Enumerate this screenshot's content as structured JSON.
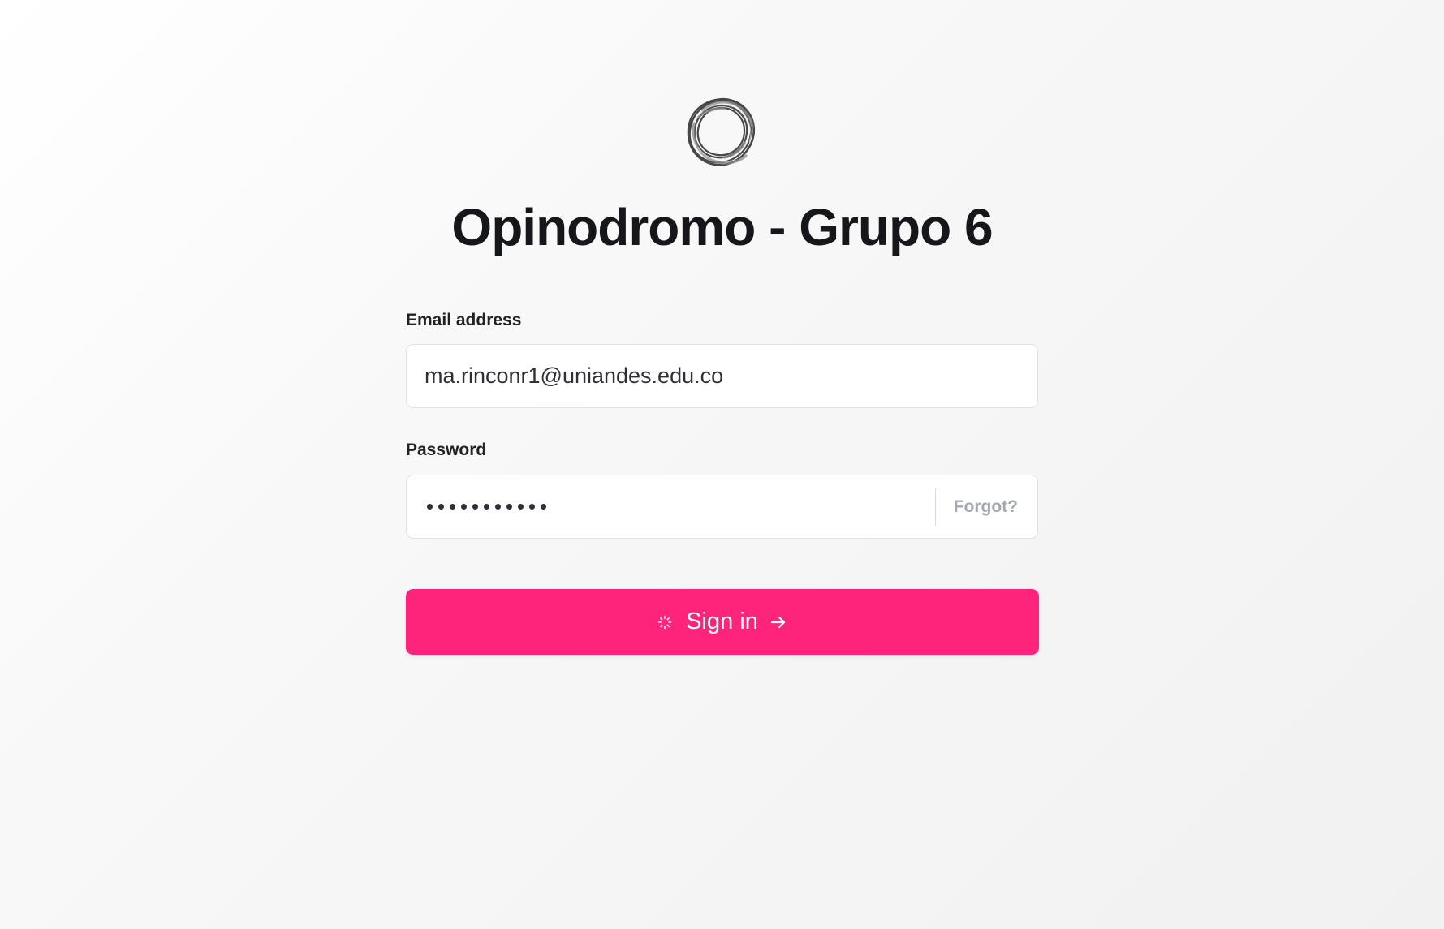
{
  "app": {
    "title": "Opinodromo - Grupo 6"
  },
  "logo": {
    "icon": "ring-logo-icon",
    "description": "Circular line-art logo"
  },
  "form": {
    "email_label": "Email address",
    "email_value": "ma.rinconr1@uniandes.edu.co",
    "password_label": "Password",
    "password_value": "•••••••••••",
    "forgot_label": "Forgot?",
    "submit_label": "Sign in"
  },
  "theme": {
    "accent": "#ff247b",
    "input_border": "#dfe3e8",
    "muted_text": "#a3a9b3",
    "title_text": "#16171b"
  }
}
